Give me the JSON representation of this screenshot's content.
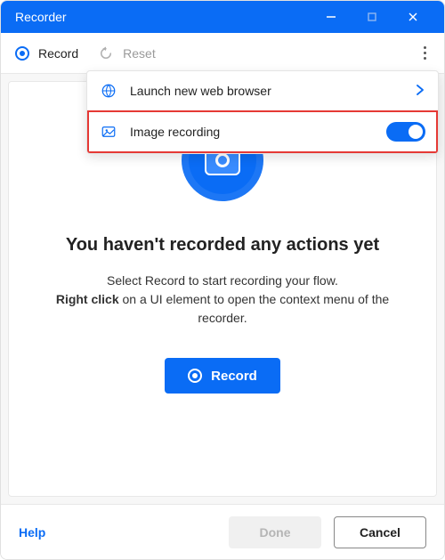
{
  "window": {
    "title": "Recorder"
  },
  "toolbar": {
    "record": "Record",
    "reset": "Reset"
  },
  "popup": {
    "launch": "Launch new web browser",
    "image_recording": "Image recording",
    "image_recording_on": true
  },
  "empty": {
    "headline": "You haven't recorded any actions yet",
    "body_pre": "Select Record to start recording your flow.",
    "body_bold": "Right click",
    "body_post": " on a UI element to open the context menu of the recorder.",
    "record_button": "Record"
  },
  "footer": {
    "help": "Help",
    "done": "Done",
    "cancel": "Cancel"
  }
}
